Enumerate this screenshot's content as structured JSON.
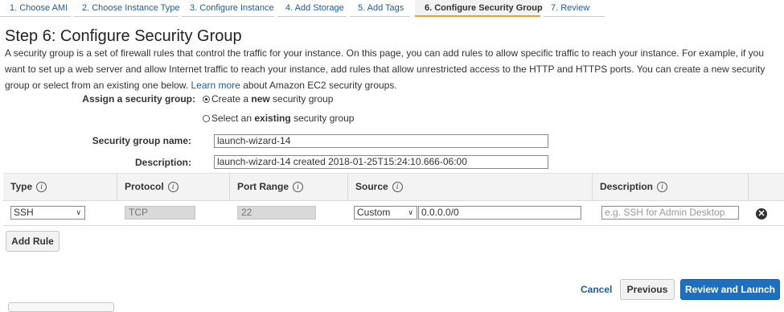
{
  "tabs": [
    {
      "label": "1. Choose AMI"
    },
    {
      "label": "2. Choose Instance Type"
    },
    {
      "label": "3. Configure Instance"
    },
    {
      "label": "4. Add Storage"
    },
    {
      "label": "5. Add Tags"
    },
    {
      "label": "6. Configure Security Group",
      "active": true
    },
    {
      "label": "7. Review"
    }
  ],
  "page": {
    "title": "Step 6: Configure Security Group",
    "description_before": "A security group is a set of firewall rules that control the traffic for your instance. On this page, you can add rules to allow specific traffic to reach your instance. For example, if you want to set up a web server and allow Internet traffic to reach your instance, add rules that allow unrestricted access to the HTTP and HTTPS ports. You can create a new security group or select from an existing one below.",
    "learn_more": "Learn more",
    "description_after": "about Amazon EC2 security groups."
  },
  "assign": {
    "label": "Assign a security group:",
    "option_new": {
      "pre": "Create a ",
      "bold": "new",
      "post": " security group",
      "selected": true
    },
    "option_existing": {
      "pre": "Select an ",
      "bold": "existing",
      "post": " security group",
      "selected": false
    }
  },
  "form": {
    "name_label": "Security group name:",
    "name_value": "launch-wizard-14",
    "desc_label": "Description:",
    "desc_value": "launch-wizard-14 created 2018-01-25T15:24:10.666-06:00"
  },
  "table": {
    "headers": {
      "type": "Type",
      "protocol": "Protocol",
      "port_range": "Port Range",
      "source": "Source",
      "description": "Description"
    },
    "info_glyph": "i",
    "rows": [
      {
        "type": "SSH",
        "protocol": "TCP",
        "port_range": "22",
        "source_mode": "Custom",
        "source_value": "0.0.0.0/0",
        "description_placeholder": "e.g. SSH for Admin Desktop"
      }
    ]
  },
  "icons": {
    "chevron": "∨",
    "delete": "✕"
  },
  "buttons": {
    "add_rule": "Add Rule",
    "cancel": "Cancel",
    "previous": "Previous",
    "review_launch": "Review and Launch"
  },
  "colors": {
    "link": "#1f5c99",
    "accent_tab": "#e7a23c",
    "primary_button": "#1f6fbf"
  }
}
